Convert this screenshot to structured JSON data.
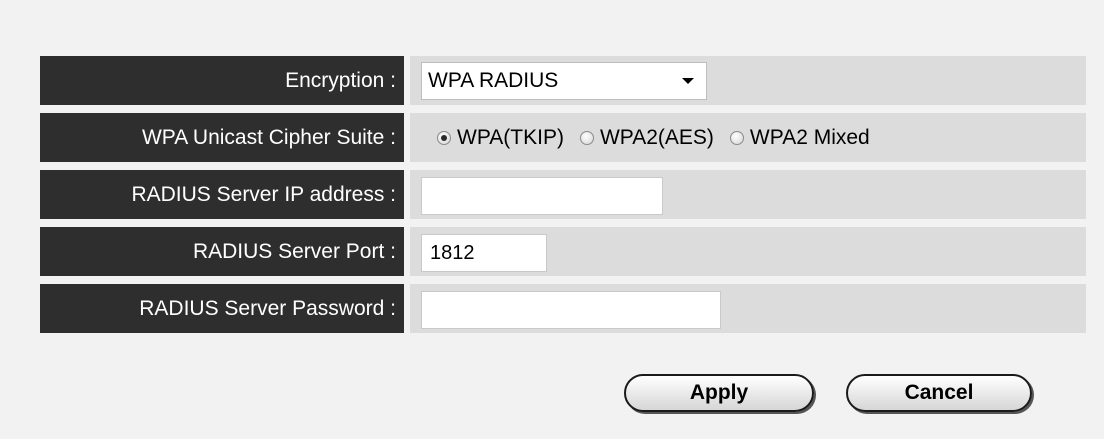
{
  "fields": {
    "encryption": {
      "label": "Encryption :",
      "selected": "WPA RADIUS"
    },
    "cipher_suite": {
      "label": "WPA Unicast Cipher Suite :",
      "options": [
        "WPA(TKIP)",
        "WPA2(AES)",
        "WPA2 Mixed"
      ],
      "selected_index": 0
    },
    "radius_ip": {
      "label": "RADIUS Server IP address :",
      "value": ""
    },
    "radius_port": {
      "label": "RADIUS Server Port :",
      "value": "1812"
    },
    "radius_password": {
      "label": "RADIUS Server Password :",
      "value": ""
    }
  },
  "buttons": {
    "apply": "Apply",
    "cancel": "Cancel"
  },
  "colors": {
    "label_bg": "#2e2e2e",
    "value_bg": "#dcdcdc",
    "page_bg": "#f2f2f2"
  }
}
